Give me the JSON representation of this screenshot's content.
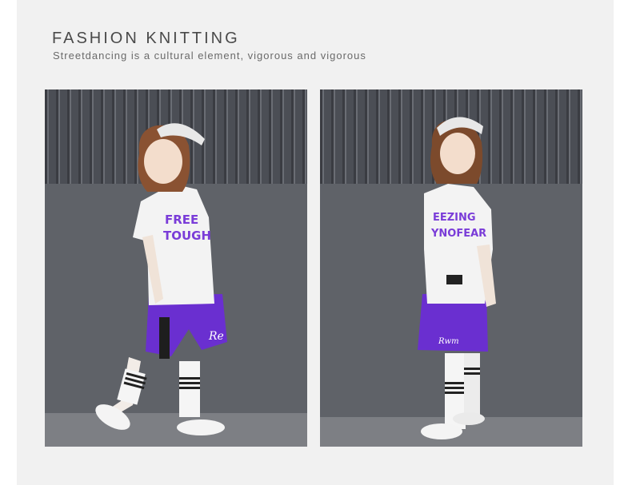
{
  "header": {
    "title": "FASHION KNITTING",
    "subtitle": "Streetdancing is a cultural element, vigorous and vigorous"
  },
  "photos": [
    {
      "description_icon": "child-model-photo-icon"
    },
    {
      "description_icon": "child-model-photo-icon"
    }
  ],
  "colors": {
    "panel": "#f1f1f1",
    "wall": "#5c5f66",
    "shorts": "#6a2fd0",
    "print": "#7a3cd8"
  }
}
